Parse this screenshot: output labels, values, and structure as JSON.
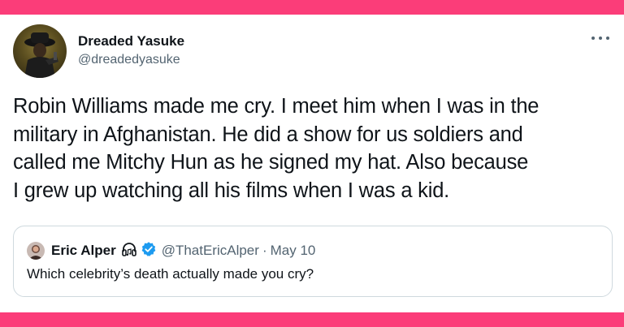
{
  "colors": {
    "frame": "#fb3d79",
    "verified": "#1d9bf0",
    "secondary_text": "#536471"
  },
  "tweet": {
    "author": {
      "name": "Dreaded Yasuke",
      "handle": "@dreadedyasuke",
      "avatar_icon": "avatar-image"
    },
    "more_icon": "more-options-icon",
    "text_lines": [
      "Robin Williams made me cry. I meet him when I was in the",
      "military in Afghanistan. He did a show for us soldiers and",
      "called me Mitchy Hun as he signed my hat. Also because",
      "I grew up watching all his films when I was a kid."
    ]
  },
  "quote": {
    "author": {
      "name": "Eric Alper",
      "handle": "@ThatEricAlper",
      "separator": "·",
      "date": "May 10",
      "emoji_icon": "headphones-icon",
      "verified_icon": "verified-badge-icon"
    },
    "text": "Which celebrity’s death actually made you cry?"
  }
}
